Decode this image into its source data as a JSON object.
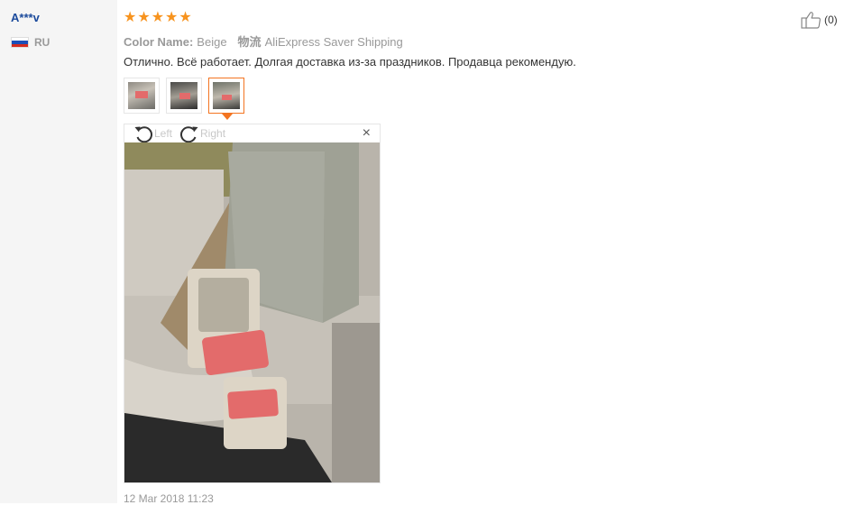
{
  "reviewer": {
    "name": "A***v",
    "country_code": "RU",
    "flag_colors": [
      "#ffffff",
      "#1c4fb8",
      "#d52b1e"
    ]
  },
  "review": {
    "rating": 5,
    "stars": [
      "★",
      "★",
      "★",
      "★",
      "★"
    ],
    "color_label": "Color Name:",
    "color_value": "Beige",
    "shipping_label": "物流",
    "shipping_value": "AliExpress Saver Shipping",
    "text": "Отлично. Всё работает. Долгая доставка из-за праздников. Продавца рекомендую.",
    "helpful_count": "(0)",
    "date": "12 Mar 2018 11:23"
  },
  "viewer": {
    "rotate_left_label": "Left",
    "rotate_right_label": "Right",
    "close_symbol": "×",
    "selected_photo_index": 3
  },
  "icons": {
    "thumbs_up": "thumbs-up-icon",
    "rotate_left": "rotate-left-icon",
    "rotate_right": "rotate-right-icon",
    "close": "close-icon"
  },
  "colors": {
    "star": "#f7931e",
    "username": "#1b4a9c",
    "active_thumb_border": "#f37421",
    "seatbelt_buckle": "#e36b6b"
  }
}
